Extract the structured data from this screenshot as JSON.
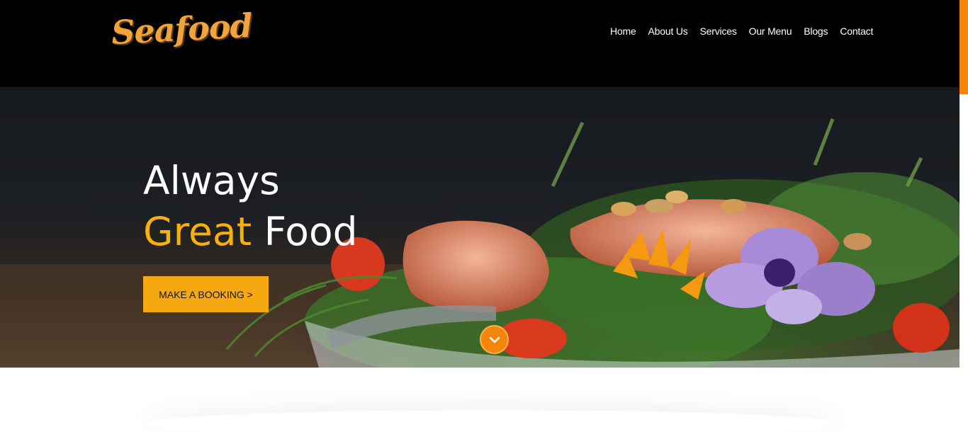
{
  "brand": {
    "logo_text": "Seafood",
    "accent_color": "#f6a811"
  },
  "nav": {
    "items": [
      {
        "label": "Home"
      },
      {
        "label": "About Us"
      },
      {
        "label": "Services"
      },
      {
        "label": "Our Menu"
      },
      {
        "label": "Blogs"
      },
      {
        "label": "Contact"
      }
    ]
  },
  "hero": {
    "title_line1": "Always",
    "title_accent": "Great",
    "title_rest": "Food",
    "cta_label": "MAKE A BOOKING >",
    "scroll_icon": "chevron-down-icon"
  }
}
